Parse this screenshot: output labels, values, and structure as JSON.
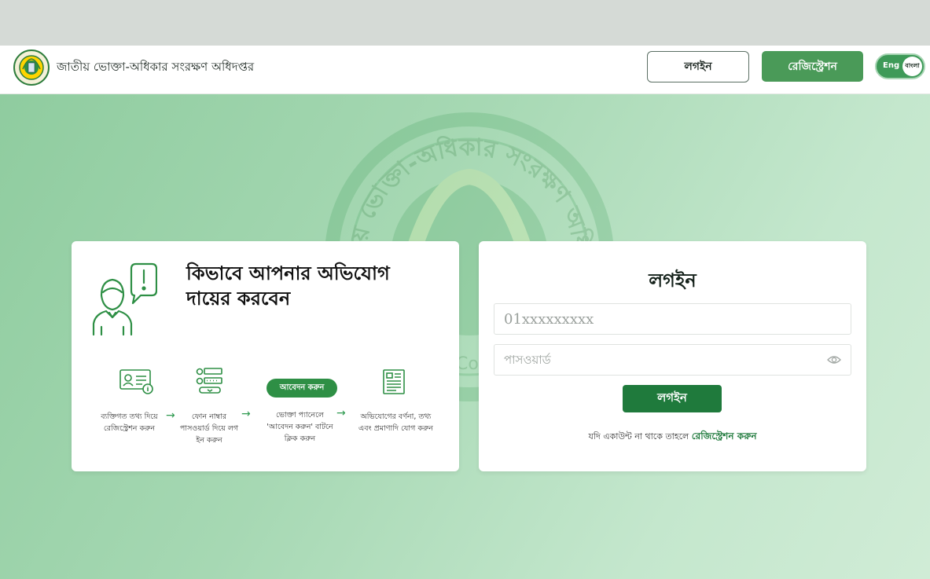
{
  "header": {
    "site_title": "জাতীয় ভোক্তা-অধিকার সংরক্ষণ অধিদপ্তর",
    "login_button": "লগইন",
    "register_button": "রেজিস্ট্রেশন",
    "lang_eng": "Eng",
    "lang_bangla": "বাংলা"
  },
  "watermark": {
    "arc_text": "জাতীয় ভোক্তা-অধিকার সংরক্ষণ অধিদপ্তর",
    "partial_text": "Con"
  },
  "howto": {
    "title_line1": "কিভাবে আপনার অভিযোগ",
    "title_line2": "দায়ের করবেন",
    "steps": [
      {
        "line1": "ব্যক্তিগত তথ্য দিয়ে",
        "line2": "রেজিস্ট্রেশন করুন",
        "line3": ""
      },
      {
        "line1": "ফোন নাম্বার",
        "line2": "পাসওয়ার্ড দিয়ে লগ",
        "line3": "ইন করুন"
      },
      {
        "line1": "ভোক্তা প্যানেলে",
        "line2": "'আবেদন করুন' বাটনে",
        "line3": "ক্লিক করুন"
      },
      {
        "line1": "অভিযোগের বর্ণনা, তথ্য",
        "line2": "এবং প্রমাণাদি যোগ করুন",
        "line3": ""
      }
    ],
    "apply_pill": "আবেদন করুন",
    "arrow": "→"
  },
  "login": {
    "title": "লগইন",
    "phone_placeholder": "01xxxxxxxxx",
    "password_placeholder": "পাসওয়ার্ড",
    "button": "লগইন",
    "note": "যদি একাউন্ট না থাকে তাহলে",
    "register_link": "রেজিস্ট্রেশন করুন"
  },
  "colors": {
    "brand_green": "#1f7a3c",
    "register_green": "#4a9a58",
    "accent_green": "#2e9a4f"
  }
}
